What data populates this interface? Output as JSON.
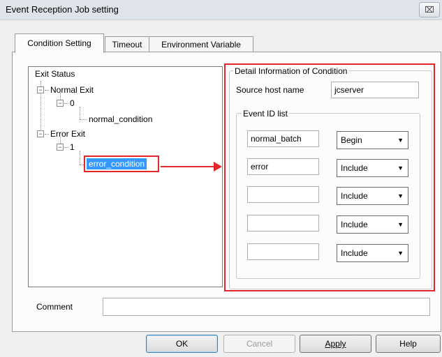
{
  "window": {
    "title": "Event Reception Job setting",
    "close_label": "⌧"
  },
  "tabs": [
    {
      "label": "Condition Setting",
      "active": true
    },
    {
      "label": "Timeout",
      "active": false
    },
    {
      "label": "Environment Variable",
      "active": false
    }
  ],
  "tree": {
    "root": "Exit Status",
    "normal_exit": "Normal Exit",
    "normal_code": "0",
    "normal_condition": "normal_condition",
    "error_exit": "Error Exit",
    "error_code": "1",
    "error_condition": "error_condition",
    "expander_symbol": "−"
  },
  "detail": {
    "group_title": "Detail Information of Condition",
    "source_host_label": "Source host name",
    "source_host_value": "jcserver",
    "event_group_title": "Event ID list",
    "events": [
      {
        "id": "normal_batch",
        "mode": "Begin"
      },
      {
        "id": "error",
        "mode": "Include"
      },
      {
        "id": "",
        "mode": "Include"
      },
      {
        "id": "",
        "mode": "Include"
      },
      {
        "id": "",
        "mode": "Include"
      }
    ],
    "dropdown_arrow": "▼"
  },
  "comment": {
    "label": "Comment",
    "value": ""
  },
  "buttons": {
    "ok": "OK",
    "cancel": "Cancel",
    "apply": "Apply",
    "help": "Help"
  },
  "colors": {
    "highlight": "#e3262b",
    "selection": "#3399ff"
  }
}
